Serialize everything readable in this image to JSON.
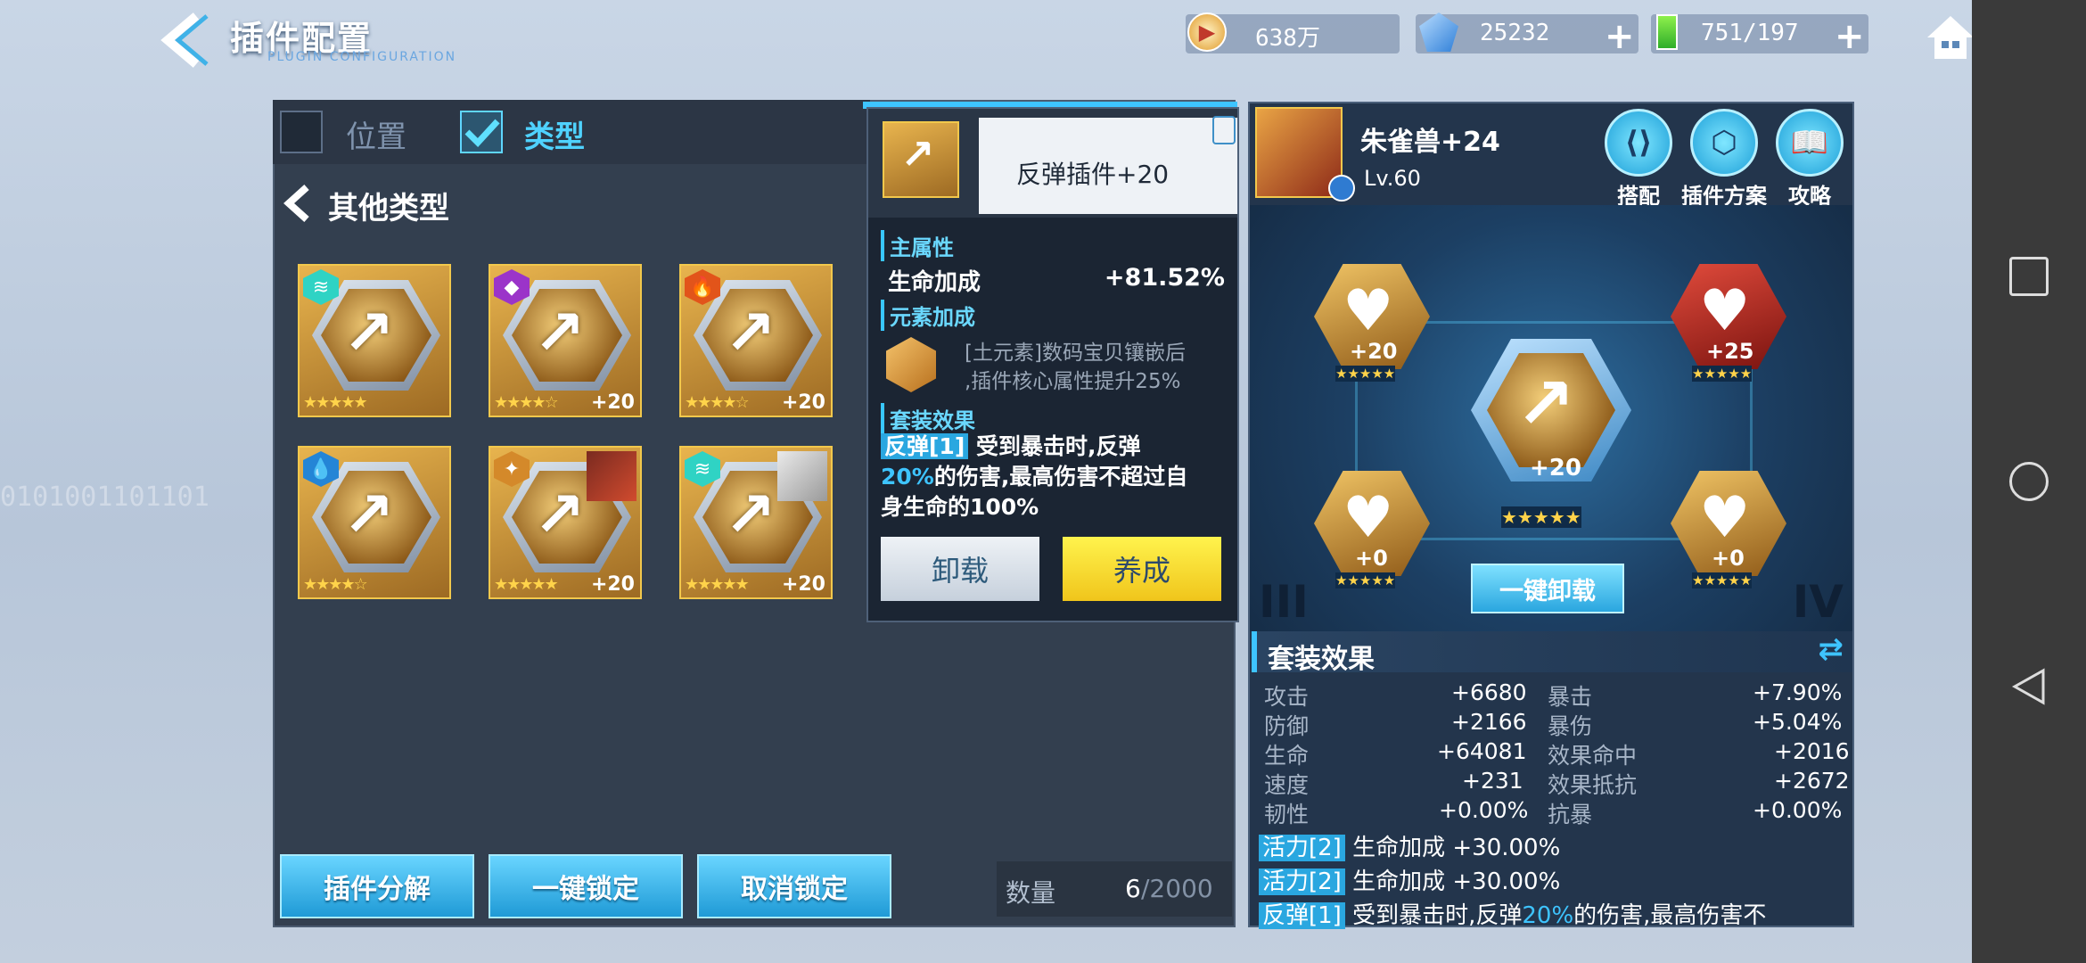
{
  "header": {
    "title": "插件配置",
    "subtitle": "PLUGIN CONFIGURATION",
    "resources": [
      {
        "name": "coins",
        "value": "638万"
      },
      {
        "name": "gems",
        "value": "25232"
      },
      {
        "name": "energy",
        "value": "751/197"
      }
    ]
  },
  "filters": {
    "position_label": "位置",
    "type_label": "类型"
  },
  "category": {
    "label": "其他类型"
  },
  "plugins": [
    {
      "stars": "★★★★★",
      "level": "",
      "element_color": "#2fd3c4"
    },
    {
      "stars": "★★★★☆",
      "level": "+20",
      "element_color": "#9b34c9"
    },
    {
      "stars": "★★★★☆",
      "level": "+20",
      "element_color": "#e2541a"
    },
    {
      "stars": "★★★★☆",
      "level": "",
      "element_color": "#2485d6"
    },
    {
      "stars": "★★★★★",
      "level": "+20",
      "element_color": "#d4892a"
    },
    {
      "stars": "★★★★★",
      "level": "+20",
      "element_color": "#2fd3c4"
    }
  ],
  "bottom": {
    "decompose": "插件分解",
    "lock_all": "一键锁定",
    "unlock": "取消锁定",
    "count_label": "数量",
    "count_value": "6",
    "count_max": "/2000"
  },
  "popup": {
    "name": "反弹插件+20",
    "main_attr_title": "主属性",
    "main_attr_name": "生命加成",
    "main_attr_value": "+81.52%",
    "element_title": "元素加成",
    "element_desc1": "[土元素]数码宝贝镶嵌后",
    "element_desc2": ",插件核心属性提升25%",
    "set_title": "套装效果",
    "set_tag": "反弹[1]",
    "set_desc_a": "受到暴击时,反弹",
    "set_desc_pct": "20%",
    "set_desc_b": "的伤害,最高伤害不超过自",
    "set_desc_c": "身生命的100%",
    "unload": "卸载",
    "train": "养成"
  },
  "monster": {
    "name": "朱雀兽+24",
    "level": "Lv.60"
  },
  "right_buttons": {
    "match": "搭配",
    "scheme": "插件方案",
    "guide": "攻略"
  },
  "slots": [
    {
      "level": "+20",
      "stars": "★★★★★"
    },
    {
      "level": "+25",
      "stars": "★★★★★"
    },
    {
      "level": "+20",
      "stars": "★★★★★"
    },
    {
      "level": "+0",
      "stars": "★★★★★"
    },
    {
      "level": "+0",
      "stars": "★★★★★"
    }
  ],
  "unload_all": "一键卸载",
  "roman": {
    "left": "III",
    "right": "IV"
  },
  "set_panel": {
    "title": "套装效果",
    "stats": [
      {
        "k1": "攻击",
        "v1": "+6680",
        "k2": "暴击",
        "v2": "+7.90%"
      },
      {
        "k1": "防御",
        "v1": "+2166",
        "k2": "暴伤",
        "v2": "+5.04%"
      },
      {
        "k1": "生命",
        "v1": "+64081",
        "k2": "效果命中",
        "v2": "+2016"
      },
      {
        "k1": "速度",
        "v1": "+231",
        "k2": "效果抵抗",
        "v2": "+2672"
      },
      {
        "k1": "韧性",
        "v1": "+0.00%",
        "k2": "抗暴",
        "v2": "+0.00%"
      }
    ],
    "effects": [
      {
        "tag": "活力[2]",
        "text": "生命加成 +30.00%"
      },
      {
        "tag": "活力[2]",
        "text": "生命加成 +30.00%"
      },
      {
        "tag": "反弹[1]",
        "text_a": "受到暴击时,反弹",
        "pct": "20%",
        "text_b": "的伤害,最高伤害不"
      }
    ]
  }
}
